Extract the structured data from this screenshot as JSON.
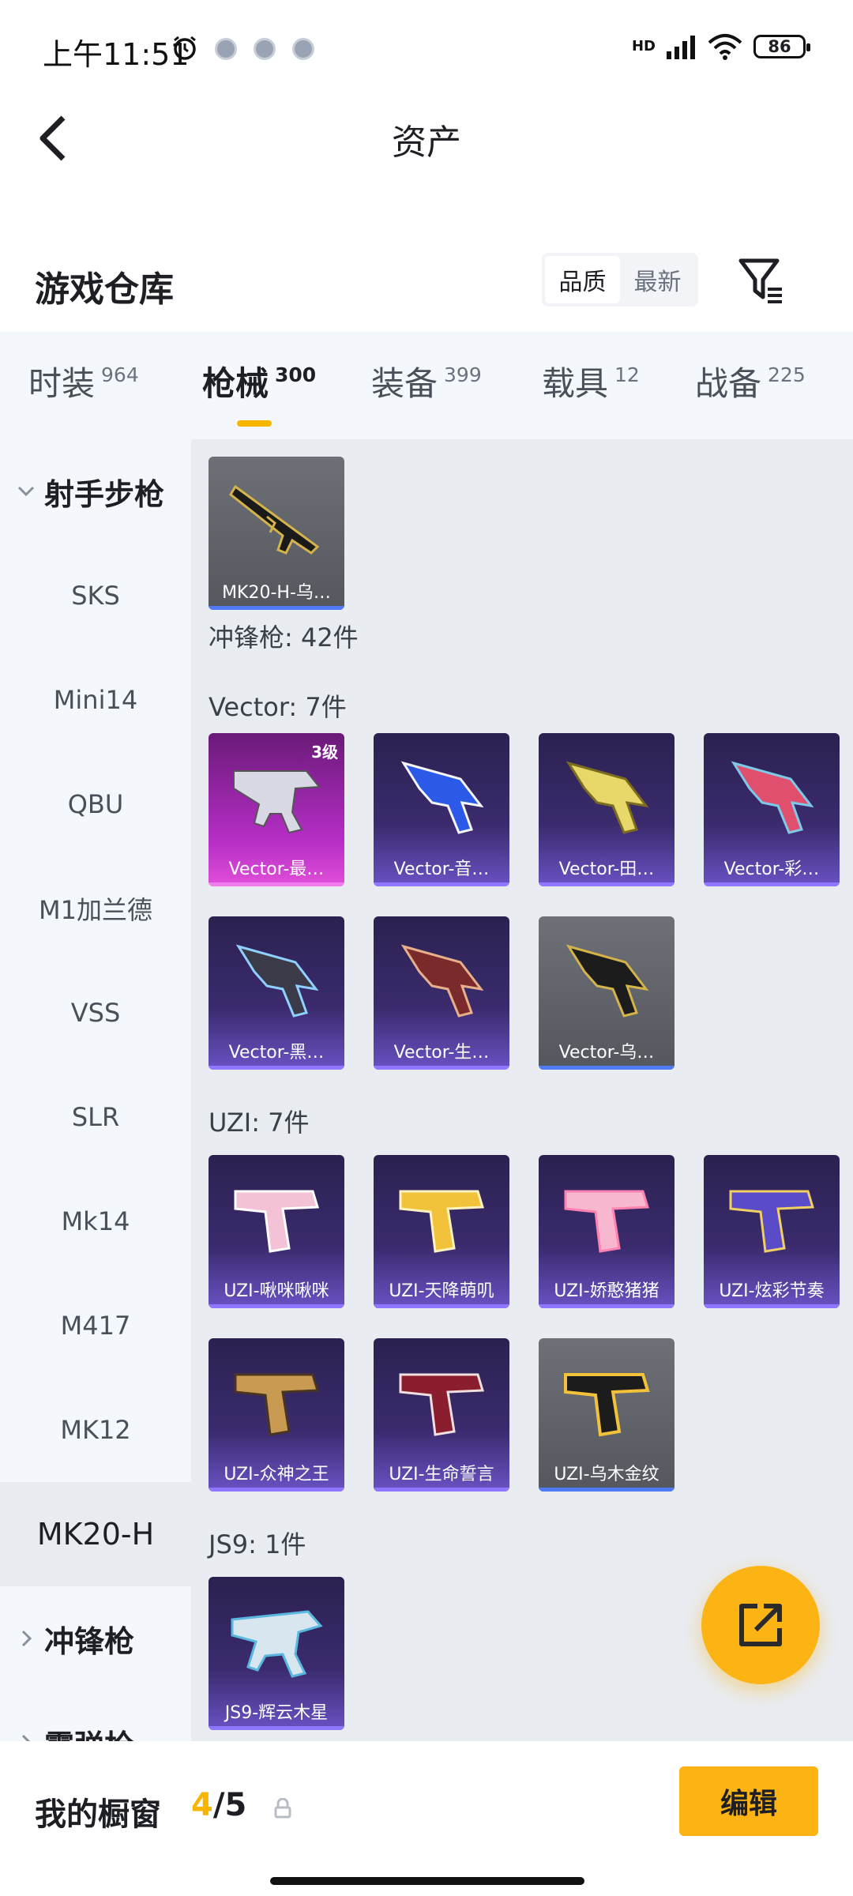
{
  "status_bar": {
    "time": "上午11:51",
    "network": "HD",
    "battery": "86"
  },
  "header": {
    "title": "资产"
  },
  "warehouse": {
    "title": "游戏仓库",
    "sort_options": [
      "品质",
      "最新"
    ],
    "active_sort": "品质"
  },
  "categories": [
    {
      "label": "时装",
      "count": "964"
    },
    {
      "label": "枪械",
      "count": "300",
      "active": true
    },
    {
      "label": "装备",
      "count": "399"
    },
    {
      "label": "载具",
      "count": "12"
    },
    {
      "label": "战备",
      "count": "225"
    }
  ],
  "sidebar": {
    "group_open": "射手步枪",
    "items": [
      "SKS",
      "Mini14",
      "QBU",
      "M1加兰德",
      "VSS",
      "SLR",
      "Mk14",
      "M417",
      "MK12",
      "MK20-H"
    ],
    "active_item": "MK20-H",
    "group_next": "冲锋枪",
    "group_cut": "霰弹枪"
  },
  "content": {
    "top_card": {
      "name": "MK20-H-乌…",
      "rarity": "grey"
    },
    "smg_summary": "冲锋枪: 42件",
    "vector": {
      "label": "Vector: 7件",
      "cards": [
        {
          "name": "Vector-最…",
          "level": "3级",
          "rarity": "pink"
        },
        {
          "name": "Vector-音…",
          "rarity": "purple"
        },
        {
          "name": "Vector-田…",
          "rarity": "purple"
        },
        {
          "name": "Vector-彩…",
          "rarity": "purple"
        },
        {
          "name": "Vector-黑…",
          "rarity": "purple"
        },
        {
          "name": "Vector-生…",
          "rarity": "purple"
        },
        {
          "name": "Vector-乌…",
          "rarity": "grey"
        }
      ]
    },
    "uzi": {
      "label": "UZI: 7件",
      "cards": [
        {
          "name": "UZI-啾咪啾咪",
          "rarity": "purple"
        },
        {
          "name": "UZI-天降萌叽",
          "rarity": "purple"
        },
        {
          "name": "UZI-娇憨猪猪",
          "rarity": "purple"
        },
        {
          "name": "UZI-炫彩节奏",
          "rarity": "purple"
        },
        {
          "name": "UZI-众神之王",
          "rarity": "purple"
        },
        {
          "name": "UZI-生命誓言",
          "rarity": "purple"
        },
        {
          "name": "UZI-乌木金纹",
          "rarity": "grey"
        }
      ]
    },
    "js9": {
      "label": "JS9: 1件",
      "cards": [
        {
          "name": "JS9-辉云木星",
          "rarity": "purple"
        }
      ]
    }
  },
  "bottom": {
    "showcase_label": "我的橱窗",
    "showcase_current": "4",
    "showcase_max": "/5",
    "edit_label": "编辑"
  },
  "colors": {
    "accent": "#fbb414",
    "underline": "#f7b500"
  }
}
